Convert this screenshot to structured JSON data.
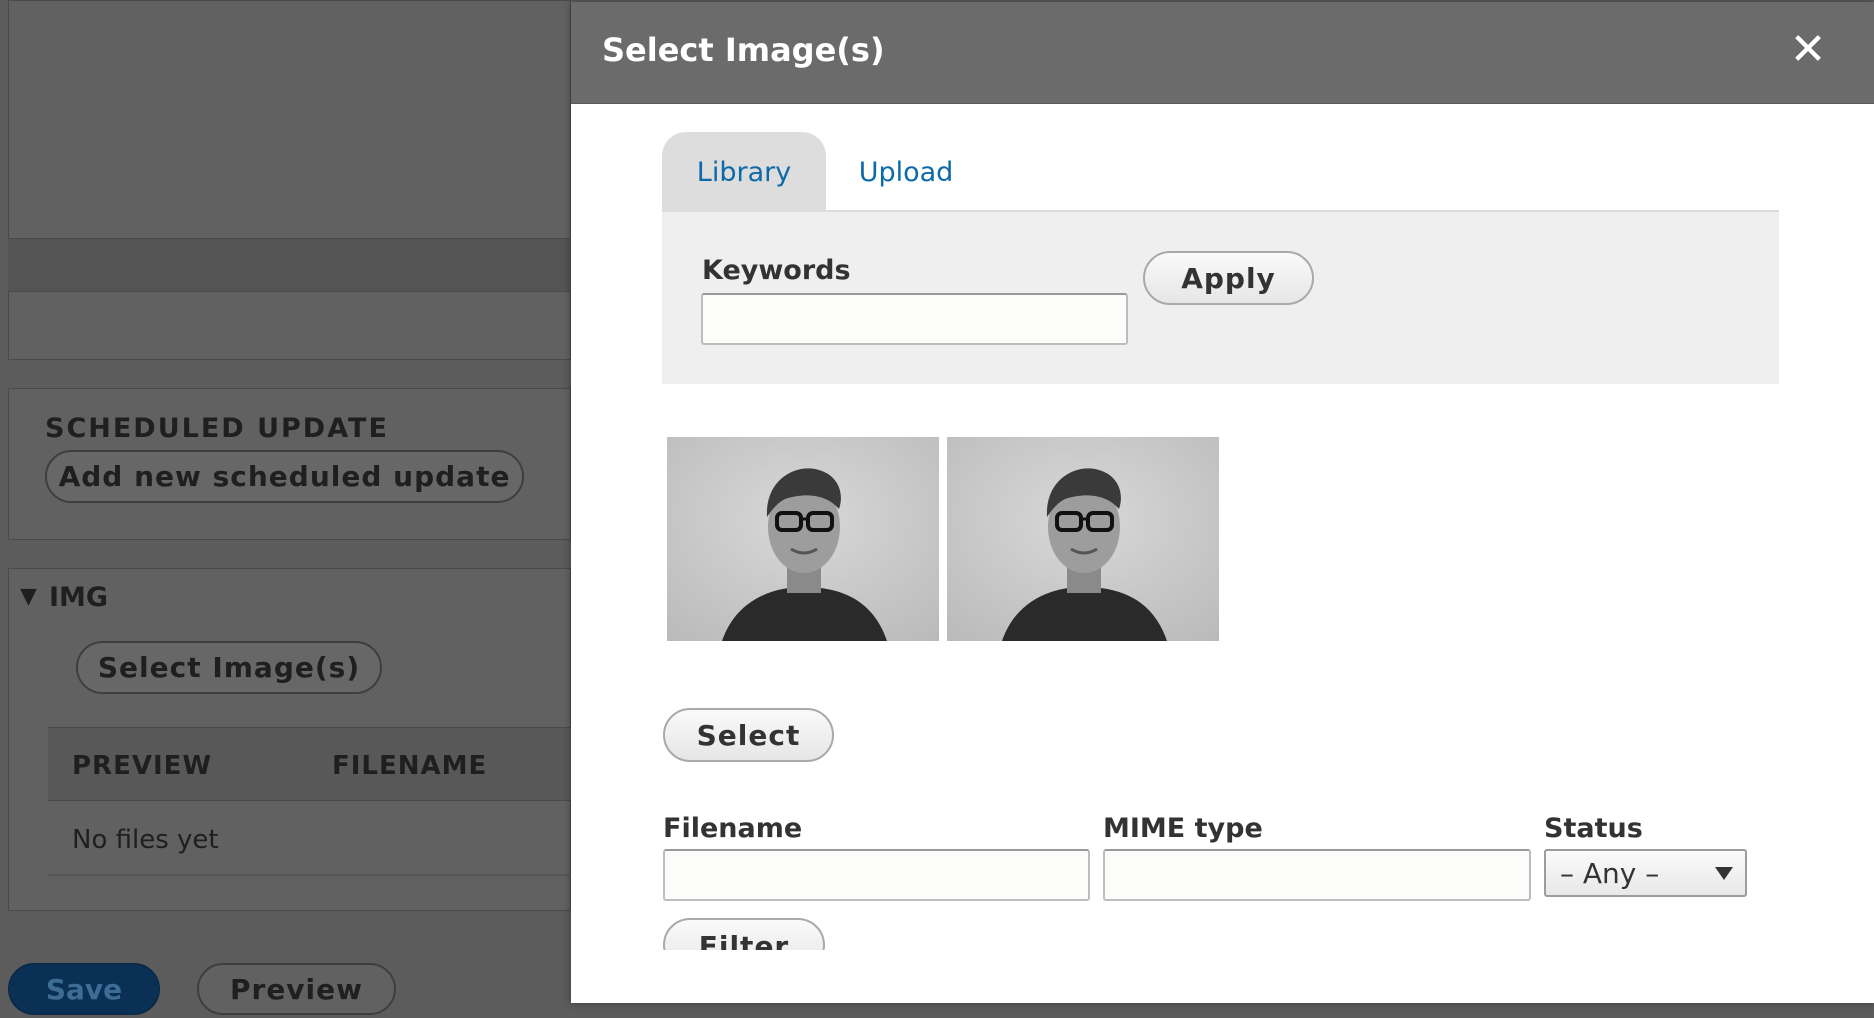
{
  "background": {
    "scheduled_update_heading": "SCHEDULED UPDATE",
    "add_scheduled_update_button": "Add new scheduled update",
    "img_section_toggle": "▼",
    "img_section_label": "IMG",
    "select_images_button": "Select Image(s)",
    "table_headers": [
      "PREVIEW",
      "FILENAME"
    ],
    "table_empty_text": "No files yet",
    "save_button": "Save",
    "preview_button": "Preview"
  },
  "modal": {
    "title": "Select Image(s)",
    "close_icon": "✕",
    "tabs": [
      {
        "label": "Library",
        "active": true
      },
      {
        "label": "Upload",
        "active": false
      }
    ],
    "keywords_label": "Keywords",
    "keywords_value": "",
    "apply_button": "Apply",
    "thumbnails": [
      {
        "alt": "Portrait photo of a man with glasses"
      },
      {
        "alt": "Portrait photo of a man with glasses"
      }
    ],
    "select_button": "Select",
    "filename_label": "Filename",
    "filename_value": "",
    "mime_label": "MIME type",
    "mime_value": "",
    "status_label": "Status",
    "status_selected": "– Any –",
    "filter_button": "Filter"
  },
  "colors": {
    "overlay": "#5c5c5c",
    "modal_titlebar": "#6b6b6b",
    "link_blue": "#0d6aa8",
    "save_primary": "#0a3155"
  }
}
